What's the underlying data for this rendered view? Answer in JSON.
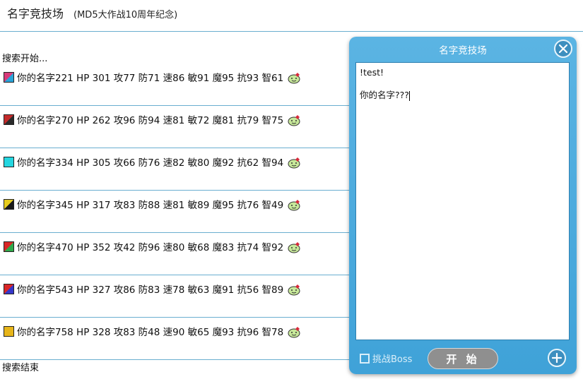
{
  "header": {
    "title": "名字竞技场",
    "subtitle": "(MD5大作战10周年纪念)"
  },
  "log": {
    "start_text": "搜索开始...",
    "end_text": "搜索结束",
    "rows": [
      {
        "text": "你的名字221 HP 301 攻77 防71 速86 敏91 魔95 抗93 智61",
        "avatar_colors": [
          "#d83a7a",
          "#2aa3d8"
        ]
      },
      {
        "text": "你的名字270 HP 262 攻96 防94 速81 敏72 魔81 抗79 智75",
        "avatar_colors": [
          "#c42a2a",
          "#2b2b2b"
        ]
      },
      {
        "text": "你的名字334 HP 305 攻66 防76 速82 敏80 魔92 抗62 智94",
        "avatar_colors": [
          "#25d6e0",
          "#25d6e0"
        ]
      },
      {
        "text": "你的名字345 HP 317 攻83 防88 速81 敏89 魔95 抗76 智49",
        "avatar_colors": [
          "#e6cc1c",
          "#1a1a1a"
        ]
      },
      {
        "text": "你的名字470 HP 352 攻42 防96 速80 敏68 魔83 抗74 智92",
        "avatar_colors": [
          "#d92626",
          "#2fa84a"
        ]
      },
      {
        "text": "你的名字543 HP 327 攻86 防83 速78 敏63 魔91 抗56 智89",
        "avatar_colors": [
          "#d92626",
          "#3536c9"
        ]
      },
      {
        "text": "你的名字758 HP 328 攻83 防48 速90 敏65 魔93 抗96 智78",
        "avatar_colors": [
          "#e7b51a",
          "#e7b51a"
        ]
      }
    ],
    "emoji_icon": "smiley-with-heart-icon"
  },
  "panel": {
    "title": "名字竞技场",
    "textarea_lines": [
      "!test!",
      "",
      "你的名字???"
    ],
    "boss_label": "挑战Boss",
    "start_label": "开 始",
    "close_icon": "close-icon",
    "add_icon": "plus-icon"
  },
  "colors": {
    "panel_bg": "#3fa2d8",
    "divider": "#6aaed0",
    "start_btn": "#8f8f8f"
  }
}
